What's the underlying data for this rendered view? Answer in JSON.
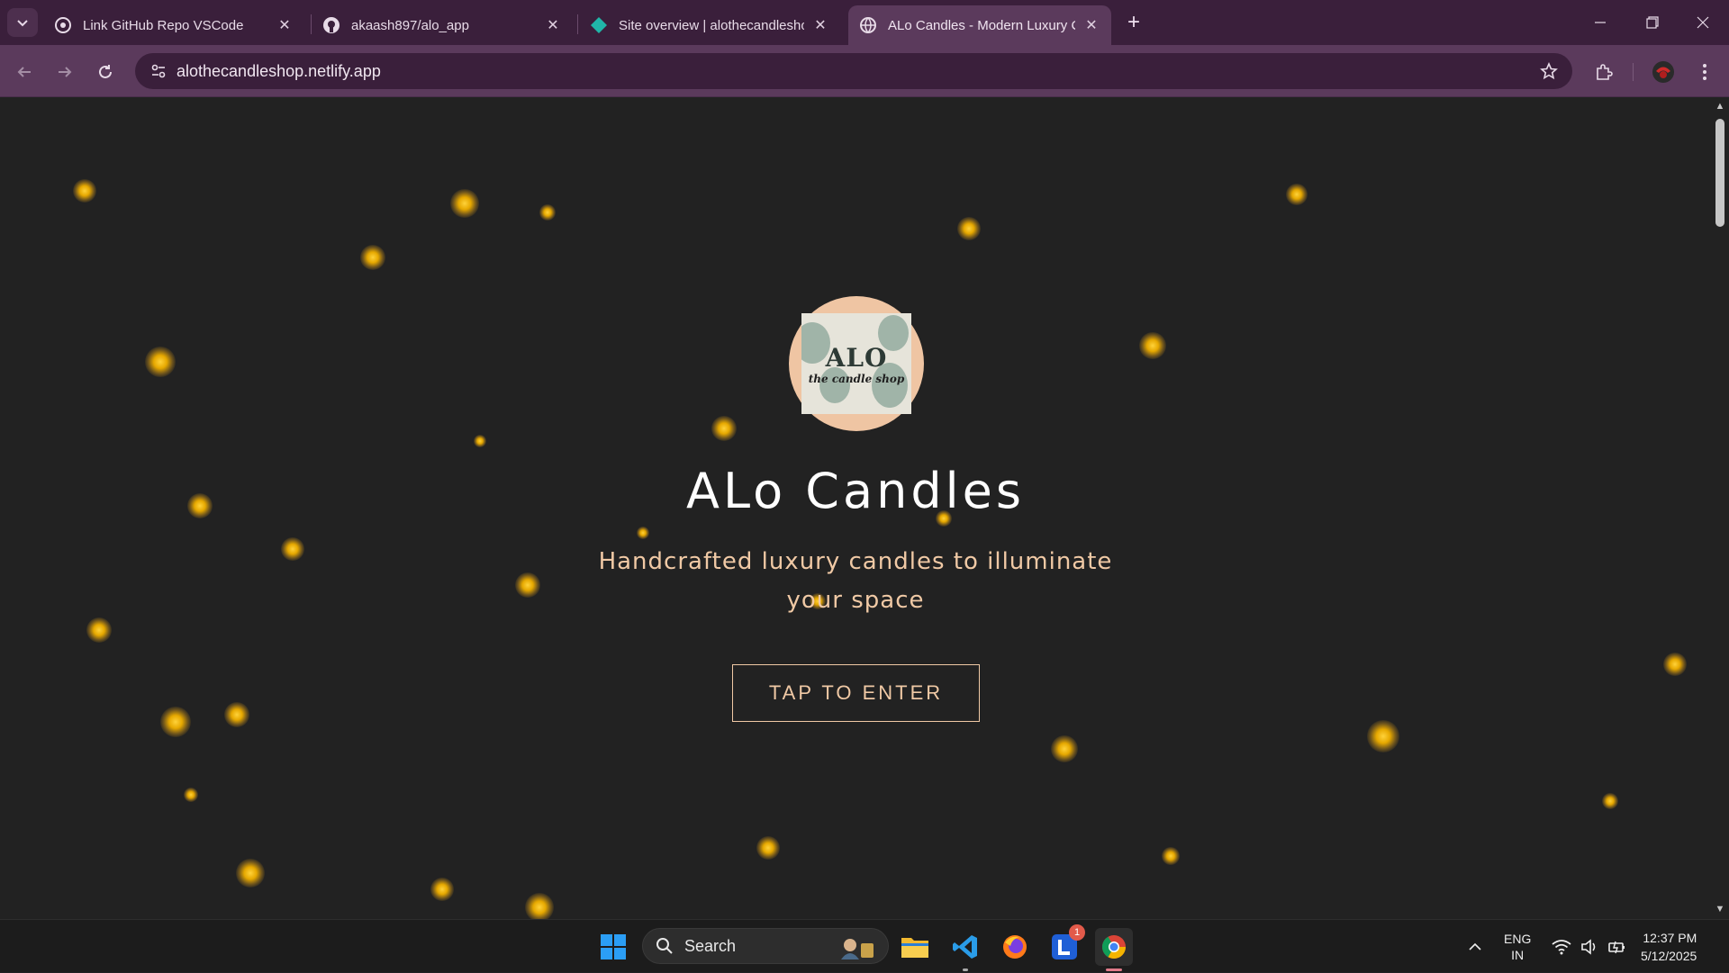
{
  "browser": {
    "tabs": [
      {
        "title": "Link GitHub Repo VSCode",
        "icon": "openai-icon"
      },
      {
        "title": "akaash897/alo_app",
        "icon": "github-icon"
      },
      {
        "title": "Site overview | alothecandleshop",
        "icon": "netlify-icon"
      },
      {
        "title": "ALo Candles - Modern Luxury C",
        "icon": "globe-icon",
        "active": true
      }
    ],
    "url": "alothecandleshop.netlify.app"
  },
  "page": {
    "logo_text": "ALO",
    "logo_subtext": "the candle shop",
    "title": "ALo Candles",
    "tagline_line1": "Handcrafted luxury candles to illuminate",
    "tagline_line2": "your space",
    "enter_button": "TAP TO ENTER",
    "accent_color": "#f0c9a5",
    "background_color": "#222222"
  },
  "taskbar": {
    "search_label": "Search",
    "notification_count": "1",
    "language_line1": "ENG",
    "language_line2": "IN",
    "time": "12:37 PM",
    "date": "5/12/2025"
  }
}
